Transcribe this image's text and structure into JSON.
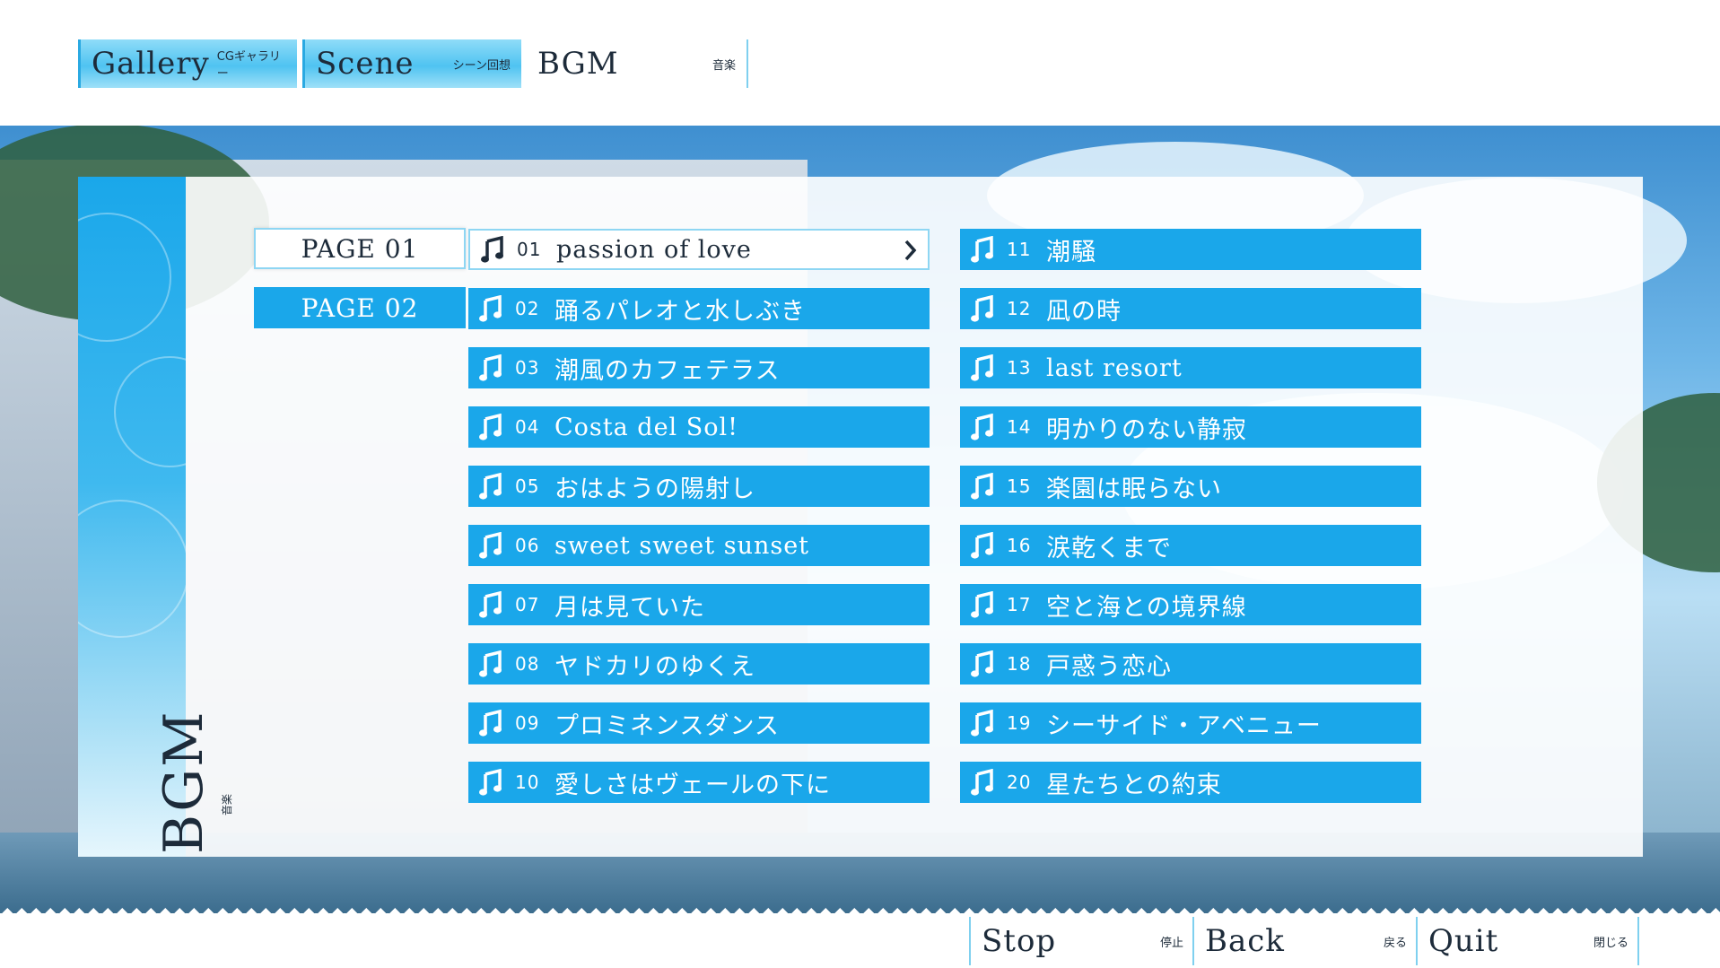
{
  "tabs": [
    {
      "label": "Gallery",
      "sub": "CGギャラリー",
      "active": false
    },
    {
      "label": "Scene",
      "sub": "シーン回想",
      "active": false
    },
    {
      "label": "BGM",
      "sub": "音楽",
      "active": true
    }
  ],
  "sidebar": {
    "title": "BGM",
    "sub": "音楽"
  },
  "pages": [
    {
      "label": "PAGE 01",
      "selected": true
    },
    {
      "label": "PAGE 02",
      "selected": false
    }
  ],
  "tracks": [
    {
      "num": "01",
      "title": "passion of love",
      "playing": true
    },
    {
      "num": "02",
      "title": "踊るパレオと水しぶき"
    },
    {
      "num": "03",
      "title": "潮風のカフェテラス"
    },
    {
      "num": "04",
      "title": "Costa del Sol!"
    },
    {
      "num": "05",
      "title": "おはようの陽射し"
    },
    {
      "num": "06",
      "title": "sweet sweet sunset"
    },
    {
      "num": "07",
      "title": "月は見ていた"
    },
    {
      "num": "08",
      "title": "ヤドカリのゆくえ"
    },
    {
      "num": "09",
      "title": "プロミネンスダンス"
    },
    {
      "num": "10",
      "title": "愛しさはヴェールの下に"
    },
    {
      "num": "11",
      "title": "潮騒"
    },
    {
      "num": "12",
      "title": "凪の時"
    },
    {
      "num": "13",
      "title": "last resort"
    },
    {
      "num": "14",
      "title": "明かりのない静寂"
    },
    {
      "num": "15",
      "title": "楽園は眠らない"
    },
    {
      "num": "16",
      "title": "涙乾くまで"
    },
    {
      "num": "17",
      "title": "空と海との境界線"
    },
    {
      "num": "18",
      "title": "戸惑う恋心"
    },
    {
      "num": "19",
      "title": "シーサイド・アベニュー"
    },
    {
      "num": "20",
      "title": "星たちとの約束"
    }
  ],
  "bottom": [
    {
      "label": "Stop",
      "sub": "停止"
    },
    {
      "label": "Back",
      "sub": "戻る"
    },
    {
      "label": "Quit",
      "sub": "閉じる"
    }
  ],
  "colors": {
    "accent": "#1aa7ea",
    "text": "#1d2b3a",
    "selected_bg": "#ffffff"
  },
  "icons": {
    "track": "music-note-icon",
    "playing": "chevron-right-icon"
  }
}
